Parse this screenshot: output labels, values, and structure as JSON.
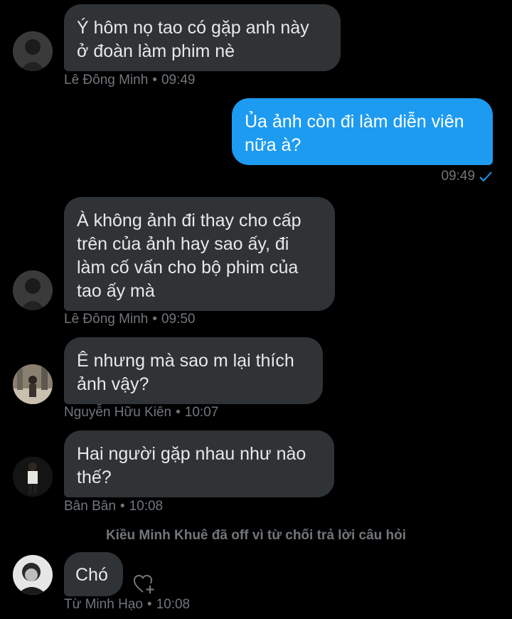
{
  "colors": {
    "background": "#000000",
    "incoming_bubble": "#2f3336",
    "outgoing_bubble": "#1d9bf0",
    "meta_text": "#71767b",
    "read_check": "#1d9bf0"
  },
  "messages": [
    {
      "text": "Ý hôm nọ tao có gặp anh này\nở đoàn làm phim nè",
      "sender": "Lê Đông Minh",
      "time": "09:49"
    },
    {
      "text": "Ủa ảnh còn đi làm diễn viên\nnữa à?",
      "time": "09:49",
      "status_icon": "read-check-icon"
    },
    {
      "text": "À không ảnh đi thay cho cấp\ntrên của ảnh hay sao ấy, đi\nlàm cố vấn cho bộ phim của\ntao ấy mà",
      "sender": "Lê Đông Minh",
      "time": "09:50"
    },
    {
      "text": "Ê nhưng mà sao m lại thích\nảnh vậy?",
      "sender": "Nguyễn Hữu Kiên",
      "time": "10:07"
    },
    {
      "text": "Hai người gặp nhau như nào\nthế?",
      "sender": "Bân Bân",
      "time": "10:08"
    },
    {
      "text": "Chó",
      "sender": "Từ Minh Hạo",
      "time": "10:08",
      "reaction_icon": "add-reaction-heart-icon"
    }
  ],
  "system_notice": "Kiều Minh Khuê đã off vì từ chối trả lời câu hỏi",
  "separator": "•"
}
